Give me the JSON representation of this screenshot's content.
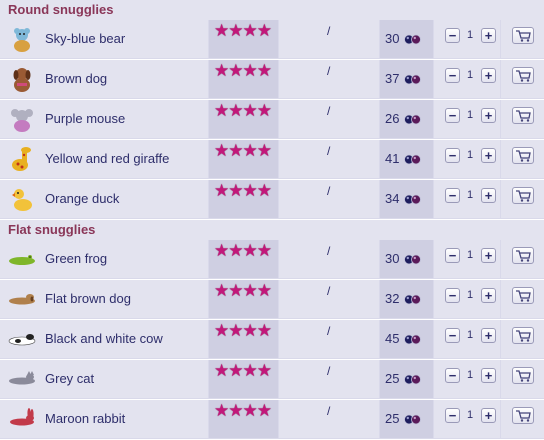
{
  "sections": [
    {
      "title": "Round snugglies",
      "items": [
        {
          "name": "Sky-blue bear",
          "rating": "★★★★",
          "separator": "/",
          "price": "30",
          "qty": "1",
          "icon": "bear-icon",
          "color": "#7fb8d8"
        },
        {
          "name": "Brown dog",
          "rating": "★★★★",
          "separator": "/",
          "price": "37",
          "qty": "1",
          "icon": "dog-icon",
          "color": "#9a5a34"
        },
        {
          "name": "Purple mouse",
          "rating": "★★★★",
          "separator": "/",
          "price": "26",
          "qty": "1",
          "icon": "mouse-icon",
          "color": "#c47bc0"
        },
        {
          "name": "Yellow and red giraffe",
          "rating": "★★★★",
          "separator": "/",
          "price": "41",
          "qty": "1",
          "icon": "giraffe-icon",
          "color": "#e8b020"
        },
        {
          "name": "Orange duck",
          "rating": "★★★★",
          "separator": "/",
          "price": "34",
          "qty": "1",
          "icon": "duck-icon",
          "color": "#f2c23a"
        }
      ]
    },
    {
      "title": "Flat snugglies",
      "items": [
        {
          "name": "Green frog",
          "rating": "★★★★",
          "separator": "/",
          "price": "30",
          "qty": "1",
          "icon": "flat-frog-icon",
          "color": "#7fb62a"
        },
        {
          "name": "Flat brown dog",
          "rating": "★★★★",
          "separator": "/",
          "price": "32",
          "qty": "1",
          "icon": "flat-dog-icon",
          "color": "#b0804c"
        },
        {
          "name": "Black and white cow",
          "rating": "★★★★",
          "separator": "/",
          "price": "45",
          "qty": "1",
          "icon": "flat-cow-icon",
          "color": "#ffffff"
        },
        {
          "name": "Grey cat",
          "rating": "★★★★",
          "separator": "/",
          "price": "25",
          "qty": "1",
          "icon": "flat-cat-icon",
          "color": "#8a8a9a"
        },
        {
          "name": "Maroon rabbit",
          "rating": "★★★★",
          "separator": "/",
          "price": "25",
          "qty": "1",
          "icon": "flat-rabbit-icon",
          "color": "#c23a4a"
        }
      ]
    }
  ],
  "labels": {
    "minus": "−",
    "plus": "+"
  },
  "theme": {
    "header_color": "#8a3658",
    "star_color": "#c2187a",
    "background": "#d9d9ea"
  }
}
